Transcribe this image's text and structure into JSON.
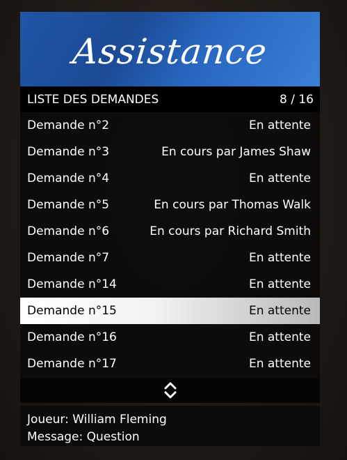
{
  "banner": {
    "title": "Assistance"
  },
  "subheader": {
    "title": "LISTE DES DEMANDES",
    "counter": "8 / 16"
  },
  "requests": [
    {
      "label": "Demande n°2",
      "status": "En attente"
    },
    {
      "label": "Demande n°3",
      "status": "En cours par James Shaw"
    },
    {
      "label": "Demande n°4",
      "status": "En attente"
    },
    {
      "label": "Demande n°5",
      "status": "En cours par Thomas Walk"
    },
    {
      "label": "Demande n°6",
      "status": "En cours par Richard Smith"
    },
    {
      "label": "Demande n°7",
      "status": "En attente"
    },
    {
      "label": "Demande n°14",
      "status": "En attente"
    },
    {
      "label": "Demande n°15",
      "status": "En attente",
      "selected": true
    },
    {
      "label": "Demande n°16",
      "status": "En attente"
    },
    {
      "label": "Demande n°17",
      "status": "En attente"
    }
  ],
  "scroll_indicator": {
    "icon": "chevron-up-down-icon"
  },
  "info": {
    "player": "Joueur: William Fleming",
    "message": "Message: Question"
  },
  "colors": {
    "banner": "#1f56a6",
    "selected_row": "#ffffff",
    "background": "#241d18"
  }
}
